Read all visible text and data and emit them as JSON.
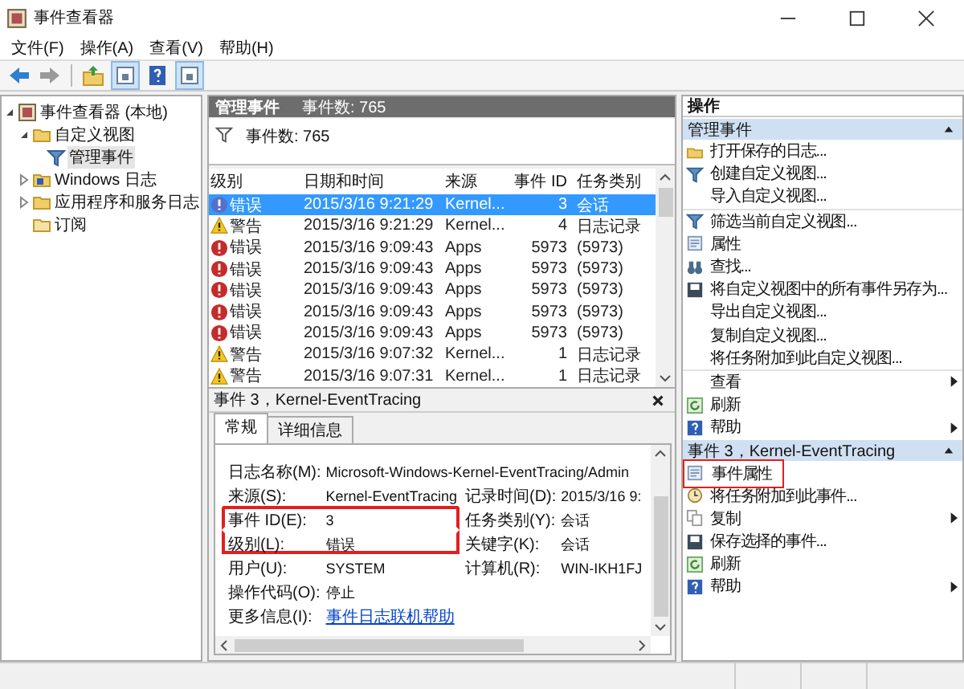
{
  "window": {
    "title": "事件查看器"
  },
  "menu": [
    "文件(F)",
    "操作(A)",
    "查看(V)",
    "帮助(H)"
  ],
  "tree": [
    {
      "label": "事件查看器 (本地)",
      "kind": "root",
      "expanded": true,
      "selected": false,
      "children": [
        {
          "label": "自定义视图",
          "kind": "folder",
          "expanded": true,
          "selected": false,
          "children": [
            {
              "label": "管理事件",
              "kind": "view",
              "selected": true
            }
          ]
        },
        {
          "label": "Windows 日志",
          "kind": "logs",
          "expanded": false,
          "selected": false
        },
        {
          "label": "应用程序和服务日志",
          "kind": "folder",
          "expanded": false,
          "selected": false
        },
        {
          "label": "订阅",
          "kind": "subscription",
          "selected": false
        }
      ]
    }
  ],
  "center": {
    "header_title": "管理事件",
    "header_count": "事件数: 765",
    "filter_count": "事件数: 765",
    "table": {
      "columns": [
        "级别",
        "日期和时间",
        "来源",
        "事件 ID",
        "任务类别"
      ],
      "rows": [
        {
          "kind": "error",
          "level": "错误",
          "time": "2015/3/16 9:21:29",
          "source": "Kernel...",
          "id": "3",
          "task": "会话",
          "selected": true
        },
        {
          "kind": "warning",
          "level": "警告",
          "time": "2015/3/16 9:21:29",
          "source": "Kernel...",
          "id": "4",
          "task": "日志记录",
          "selected": false
        },
        {
          "kind": "error",
          "level": "错误",
          "time": "2015/3/16 9:09:43",
          "source": "Apps",
          "id": "5973",
          "task": "(5973)",
          "selected": false
        },
        {
          "kind": "error",
          "level": "错误",
          "time": "2015/3/16 9:09:43",
          "source": "Apps",
          "id": "5973",
          "task": "(5973)",
          "selected": false
        },
        {
          "kind": "error",
          "level": "错误",
          "time": "2015/3/16 9:09:43",
          "source": "Apps",
          "id": "5973",
          "task": "(5973)",
          "selected": false
        },
        {
          "kind": "error",
          "level": "错误",
          "time": "2015/3/16 9:09:43",
          "source": "Apps",
          "id": "5973",
          "task": "(5973)",
          "selected": false
        },
        {
          "kind": "error",
          "level": "错误",
          "time": "2015/3/16 9:09:43",
          "source": "Apps",
          "id": "5973",
          "task": "(5973)",
          "selected": false
        },
        {
          "kind": "warning",
          "level": "警告",
          "time": "2015/3/16 9:07:32",
          "source": "Kernel...",
          "id": "1",
          "task": "日志记录",
          "selected": false
        },
        {
          "kind": "warning",
          "level": "警告",
          "time": "2015/3/16 9:07:31",
          "source": "Kernel...",
          "id": "1",
          "task": "日志记录",
          "selected": false
        }
      ]
    },
    "detail": {
      "title": "事件 3，Kernel-EventTracing",
      "tabs": [
        {
          "label": "常规",
          "selected": true
        },
        {
          "label": "详细信息",
          "selected": false
        }
      ],
      "rows": [
        {
          "fields": [
            {
              "label": "日志名称(M):",
              "value": "Microsoft-Windows-Kernel-EventTracing/Admin",
              "highlighted": false
            }
          ]
        },
        {
          "fields": [
            {
              "label": "来源(S):",
              "value": "Kernel-EventTracing",
              "highlighted": false
            },
            {
              "label": "记录时间(D):",
              "value": "2015/3/16 9:",
              "highlighted": false
            }
          ]
        },
        {
          "fields": [
            {
              "label": "事件 ID(E):",
              "value": "3",
              "highlighted": true
            },
            {
              "label": "任务类别(Y):",
              "value": "会话",
              "highlighted": false
            }
          ]
        },
        {
          "fields": [
            {
              "label": "级别(L):",
              "value": "错误",
              "highlighted": true
            },
            {
              "label": "关键字(K):",
              "value": "会话",
              "highlighted": false
            }
          ]
        },
        {
          "fields": [
            {
              "label": "用户(U):",
              "value": "SYSTEM",
              "highlighted": false
            },
            {
              "label": "计算机(R):",
              "value": "WIN-IKH1FJ",
              "highlighted": false
            }
          ]
        },
        {
          "fields": [
            {
              "label": "操作代码(O):",
              "value": "停止",
              "highlighted": false
            }
          ]
        },
        {
          "fields": [
            {
              "label": "更多信息(I):",
              "link": "事件日志联机帮助",
              "highlighted": false
            }
          ]
        }
      ]
    }
  },
  "actions": {
    "title": "操作",
    "sections": [
      {
        "title": "管理事件",
        "items": [
          {
            "label": "打开保存的日志...",
            "kind": "open"
          },
          {
            "label": "创建自定义视图...",
            "kind": "filter"
          },
          {
            "label": "导入自定义视图...",
            "kind": "plain",
            "divider_after": true
          },
          {
            "label": "筛选当前自定义视图...",
            "kind": "filter"
          },
          {
            "label": "属性",
            "kind": "properties"
          },
          {
            "label": "查找...",
            "kind": "find"
          },
          {
            "label": "将自定义视图中的所有事件另存为...",
            "kind": "save"
          },
          {
            "label": "导出自定义视图...",
            "kind": "plain"
          },
          {
            "label": "复制自定义视图...",
            "kind": "plain"
          },
          {
            "label": "将任务附加到此自定义视图...",
            "kind": "plain",
            "divider_after": true
          },
          {
            "label": "查看",
            "kind": "plain",
            "submenu": true
          },
          {
            "label": "刷新",
            "kind": "refresh"
          },
          {
            "label": "帮助",
            "kind": "help",
            "submenu": true
          }
        ]
      },
      {
        "title": "事件 3，Kernel-EventTracing",
        "items": [
          {
            "label": "事件属性",
            "kind": "properties",
            "highlighted": true
          },
          {
            "label": "将任务附加到此事件...",
            "kind": "task"
          },
          {
            "label": "复制",
            "kind": "copy",
            "submenu": true
          },
          {
            "label": "保存选择的事件...",
            "kind": "save"
          },
          {
            "label": "刷新",
            "kind": "refresh"
          },
          {
            "label": "帮助",
            "kind": "help",
            "submenu": true
          }
        ]
      }
    ]
  }
}
